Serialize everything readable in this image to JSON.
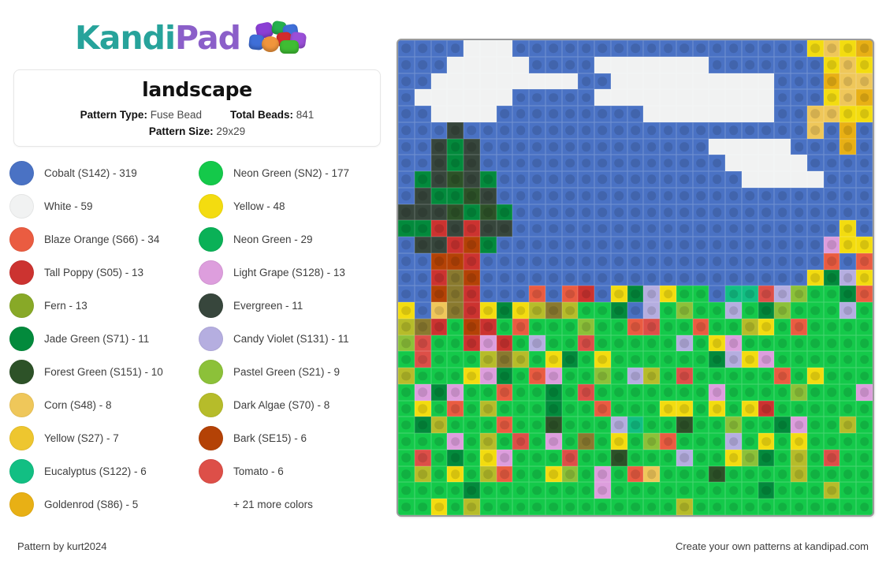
{
  "brand": {
    "name_part1": "Kandi",
    "name_part2": "Pad",
    "logo_icon": "kandi-beads-cluster-icon",
    "teal": "#27a39b",
    "purple": "#8b5fc9"
  },
  "info_card": {
    "title": "landscape",
    "pattern_type_label": "Pattern Type:",
    "pattern_type_value": "Fuse Bead",
    "total_beads_label": "Total Beads:",
    "total_beads_value": "841",
    "pattern_size_label": "Pattern Size:",
    "pattern_size_value": "29x29"
  },
  "legend": {
    "left": [
      {
        "label": "Cobalt (S142) - 319",
        "color": "#4a72c4"
      },
      {
        "label": "White - 59",
        "color": "#f1f2f2"
      },
      {
        "label": "Blaze Orange (S66) - 34",
        "color": "#ea5c41"
      },
      {
        "label": "Tall Poppy (S05) - 13",
        "color": "#cc3330"
      },
      {
        "label": "Fern - 13",
        "color": "#88a927"
      },
      {
        "label": "Jade Green (S71) - 11",
        "color": "#038a3c"
      },
      {
        "label": "Forest Green (S151) - 10",
        "color": "#2d5228"
      },
      {
        "label": "Corn (S48) - 8",
        "color": "#efc75a"
      },
      {
        "label": "Yellow (S27) - 7",
        "color": "#eec62f"
      },
      {
        "label": "Eucalyptus (S122) - 6",
        "color": "#12bf83"
      },
      {
        "label": "Goldenrod (S86) - 5",
        "color": "#e8b015"
      }
    ],
    "right": [
      {
        "label": "Neon Green (SN2) - 177",
        "color": "#14c94a"
      },
      {
        "label": "Yellow - 48",
        "color": "#f3dc10"
      },
      {
        "label": "Neon Green - 29",
        "color": "#0ab157"
      },
      {
        "label": "Light Grape (S128) - 13",
        "color": "#dd9edd"
      },
      {
        "label": "Evergreen - 11",
        "color": "#37463c"
      },
      {
        "label": "Candy Violet (S131) - 11",
        "color": "#b5aee0"
      },
      {
        "label": "Pastel Green (S21) - 9",
        "color": "#8cc139"
      },
      {
        "label": "Dark Algae (S70) - 8",
        "color": "#b6bc2a"
      },
      {
        "label": "Bark (SE15) - 6",
        "color": "#b44206"
      },
      {
        "label": "Tomato - 6",
        "color": "#dd4f48"
      }
    ],
    "more_colors": "+ 21 more colors"
  },
  "footer": {
    "left": "Pattern by kurt2024",
    "right": "Create your own patterns at kandipad.com"
  },
  "grid": {
    "width": 29,
    "height": 29,
    "palette": {
      "B": "#4a72c4",
      "W": "#f1f2f2",
      "Y": "#f3dc10",
      "C": "#efc75a",
      "G": "#e8b015",
      "y": "#eec62f",
      "N": "#14c94a",
      "n": "#0ab157",
      "J": "#038a3c",
      "F": "#2d5228",
      "E": "#37463c",
      "P": "#8cc139",
      "A": "#b6bc2a",
      "f": "#88a927",
      "O": "#ea5c41",
      "R": "#cc3330",
      "T": "#dd4f48",
      "K": "#b44206",
      "L": "#dd9edd",
      "V": "#b5aee0",
      "U": "#12bf83",
      "D": "#8a7a2f",
      "M": "#9b6640"
    },
    "rows": [
      "BBBBWWWBBBBBBBBBBBBBBBBBBYCYGCY",
      "BBBWWWWWBBBBWWWWWWWBBBBBBBYCYGCY",
      "BBWWWWWWWWWBBWWWWWWWWWWBBBGCCYGC",
      "BWWWWWWBBBBBWWWWWWWWWWWBBBYCGCYC",
      "BBWWWWBBBBBBBBBWWWWWWWWBBCCYYYG",
      "BBBEBBBBBBBBBBBBBBBBBBBBBCBGBG",
      "BBEJEBBBBBBBBBBBBBBWWWWWBBBGBG",
      "BBEJEBBBBBBBBBBBBBBBWWWWWBBBB",
      "BJEFEJBBBBBBBBBBBBBBBWWWWWBBBB",
      "BEJJFEBBBBBBBBBBBBBBBBBBBBBBB",
      "EEEFJFJBBBBBBBBBBBBBBBBBBBBBB",
      "JJREREEBBBBBBBBBBBBBBBBBBBBYB",
      "BEERKJBBBBBBBBBBBBBBBBBBBBLYYN",
      "BBKKRBBBBBBBBBBBBBBBBBBBBBOBOVN",
      "BBRDKBBBBBBBBBBBBBBBBBBBBYJVYN",
      "BBKDRBBBOBORBYJVYNNBUUTVPNNJOBN",
      "YBCDRYJYADANNJBVNPNNVNJPNNNVNY",
      "ADRNKRNONNNPNNOTNNONNAYNONNNNO",
      "PTNNRLRNVNNTNNNNNVNYLNNNNNNNNV",
      "NTNNNADANYJNYNNNNNNJVYLNNNNNNA",
      "ANNNYLJNOLNNPNVANTNNNNNONYNNNN",
      "NLJLNNONNJNTNNNNNNNLNNNNPNNNLV",
      "NYNONANNNJNNONNNYYNYNYRNNNNNNN",
      "NJANNNONNFNNNVUNNFNNPNNJLNNANN",
      "NNNLNANTNLNDNYNPONNNVNYNYNNNNN",
      "NTNJNYLNNNTNNFNNNVNNYPJNANTNNU",
      "NANYNAONNYPNLNOCNNNFNNNNANNNNN",
      "NNNNJNNNNNNNLNNNNNNNNNJNNNANNN",
      "NNYNANNNNNNNNNNNNANNNNNNNNNNN"
    ]
  }
}
